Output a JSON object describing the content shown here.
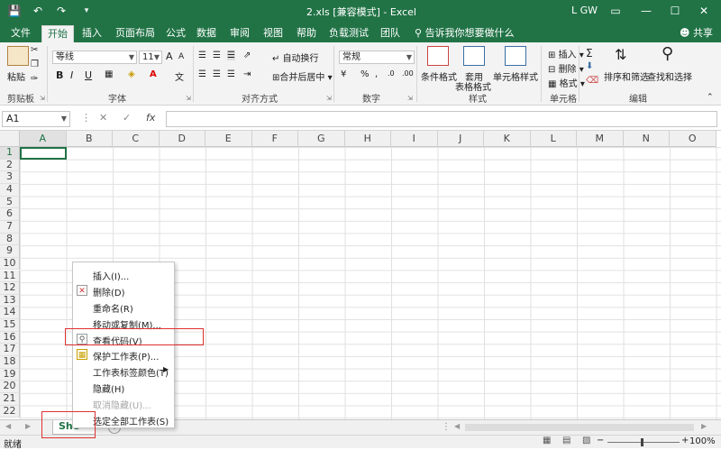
{
  "titlebar": {
    "doc_title": "2.xls [兼容模式] - Excel",
    "user": "L GW",
    "save_icon": "save-icon",
    "undo_icon": "undo-icon",
    "redo_icon": "redo-icon"
  },
  "tabs": [
    "文件",
    "开始",
    "插入",
    "页面布局",
    "公式",
    "数据",
    "审阅",
    "视图",
    "帮助",
    "负载测试",
    "团队"
  ],
  "tell_me": "告诉我你想要做什么",
  "share": "共享",
  "ribbon": {
    "clipboard": {
      "paste": "粘贴",
      "label": "剪贴板"
    },
    "font": {
      "name": "等线",
      "size": "11",
      "grow": "A",
      "shrink": "A",
      "bold": "B",
      "italic": "I",
      "underline": "U",
      "label": "字体"
    },
    "align": {
      "wrap": "自动换行",
      "merge": "合并后居中",
      "label": "对齐方式"
    },
    "number": {
      "format": "常规",
      "percent": "%",
      "label": "数字"
    },
    "styles": {
      "cond": "条件格式",
      "table": "套用",
      "table2": "表格格式",
      "cell": "单元格样式",
      "label": "样式"
    },
    "cells": {
      "insert": "插入",
      "delete": "删除",
      "format": "格式",
      "label": "单元格"
    },
    "editing": {
      "sort": "排序和筛选",
      "find": "查找和选择",
      "label": "编辑"
    }
  },
  "formula": {
    "namebox": "A1",
    "fx": "fx"
  },
  "columns": [
    "A",
    "B",
    "C",
    "D",
    "E",
    "F",
    "G",
    "H",
    "I",
    "J",
    "K",
    "L",
    "M",
    "N",
    "O"
  ],
  "rows": [
    "1",
    "2",
    "3",
    "4",
    "5",
    "6",
    "7",
    "8",
    "9",
    "10",
    "11",
    "12",
    "13",
    "14",
    "15",
    "16",
    "17",
    "18",
    "19",
    "20",
    "21",
    "22"
  ],
  "sheet_tab": "She",
  "status": {
    "text": "就绪",
    "zoom": "100%"
  },
  "context_menu": [
    {
      "label": "插入(I)...",
      "disabled": false
    },
    {
      "label": "删除(D)",
      "disabled": false
    },
    {
      "label": "重命名(R)",
      "disabled": false
    },
    {
      "label": "移动或复制(M)...",
      "disabled": false
    },
    {
      "label": "查看代码(V)",
      "disabled": false
    },
    {
      "label": "保护工作表(P)...",
      "disabled": false
    },
    {
      "label": "工作表标签颜色(T)",
      "disabled": false
    },
    {
      "label": "隐藏(H)",
      "disabled": false
    },
    {
      "label": "取消隐藏(U)...",
      "disabled": true
    },
    {
      "label": "选定全部工作表(S)",
      "disabled": false
    }
  ],
  "colors": {
    "brand": "#217346",
    "highlight": "#e03030"
  }
}
